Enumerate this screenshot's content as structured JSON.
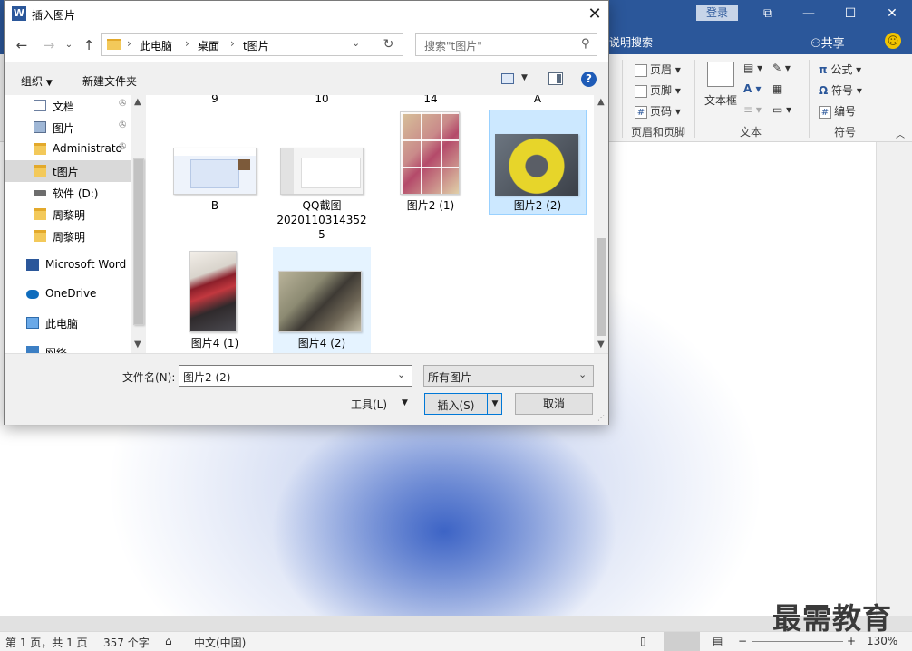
{
  "word": {
    "login_label": "登录",
    "tell_me": "说明搜索",
    "share_label": "共享",
    "ribbon": {
      "header": "页眉",
      "footer": "页脚",
      "page_number": "页码",
      "header_footer_group": "页眉和页脚",
      "textbox": "文本框",
      "text_group": "文本",
      "equation": "公式",
      "symbol": "符号",
      "number": "编号",
      "symbols_group": "符号"
    },
    "status": {
      "page": "第 1 页，共 1 页",
      "words": "357 个字",
      "language": "中文(中国)",
      "zoom": "130%"
    },
    "watermark": "最需教育"
  },
  "dialog": {
    "title": "插入图片",
    "breadcrumb": [
      "此电脑",
      "桌面",
      "t图片"
    ],
    "search_placeholder": "搜索\"t图片\"",
    "toolbar": {
      "organize": "组织",
      "new_folder": "新建文件夹"
    },
    "nav_items": [
      {
        "label": "文档",
        "pinned": true,
        "icon": "document-icon"
      },
      {
        "label": "图片",
        "pinned": true,
        "icon": "pictures-icon"
      },
      {
        "label": "Administrato",
        "pinned": true,
        "icon": "folder-icon"
      },
      {
        "label": "t图片",
        "pinned": false,
        "icon": "folder-icon",
        "selected": true
      },
      {
        "label": "软件 (D:)",
        "pinned": false,
        "icon": "drive-icon"
      },
      {
        "label": "周黎明",
        "pinned": false,
        "icon": "folder-icon"
      },
      {
        "label": "周黎明",
        "pinned": false,
        "icon": "folder-icon"
      },
      {
        "label": "Microsoft Word",
        "pinned": false,
        "icon": "word-icon"
      },
      {
        "label": "OneDrive",
        "pinned": false,
        "icon": "onedrive-icon"
      },
      {
        "label": "此电脑",
        "pinned": false,
        "icon": "this-pc-icon"
      },
      {
        "label": "网络",
        "pinned": false,
        "icon": "network-icon"
      }
    ],
    "files": {
      "partial_top": [
        "9",
        "10",
        "14",
        "A"
      ],
      "items": [
        {
          "name": "B"
        },
        {
          "name": "QQ截图20201103143525",
          "line1": "QQ截图",
          "line2": "2020110314352",
          "line3": "5"
        },
        {
          "name": "图片2 (1)"
        },
        {
          "name": "图片2 (2)",
          "selected": true
        },
        {
          "name": "图片4 (1)"
        },
        {
          "name": "图片4 (2)",
          "hover": true
        }
      ]
    },
    "filename_label": "文件名(N):",
    "filename_value": "图片2 (2)",
    "filter_value": "所有图片",
    "tools_label": "工具(L)",
    "insert_label": "插入(S)",
    "cancel_label": "取消"
  }
}
